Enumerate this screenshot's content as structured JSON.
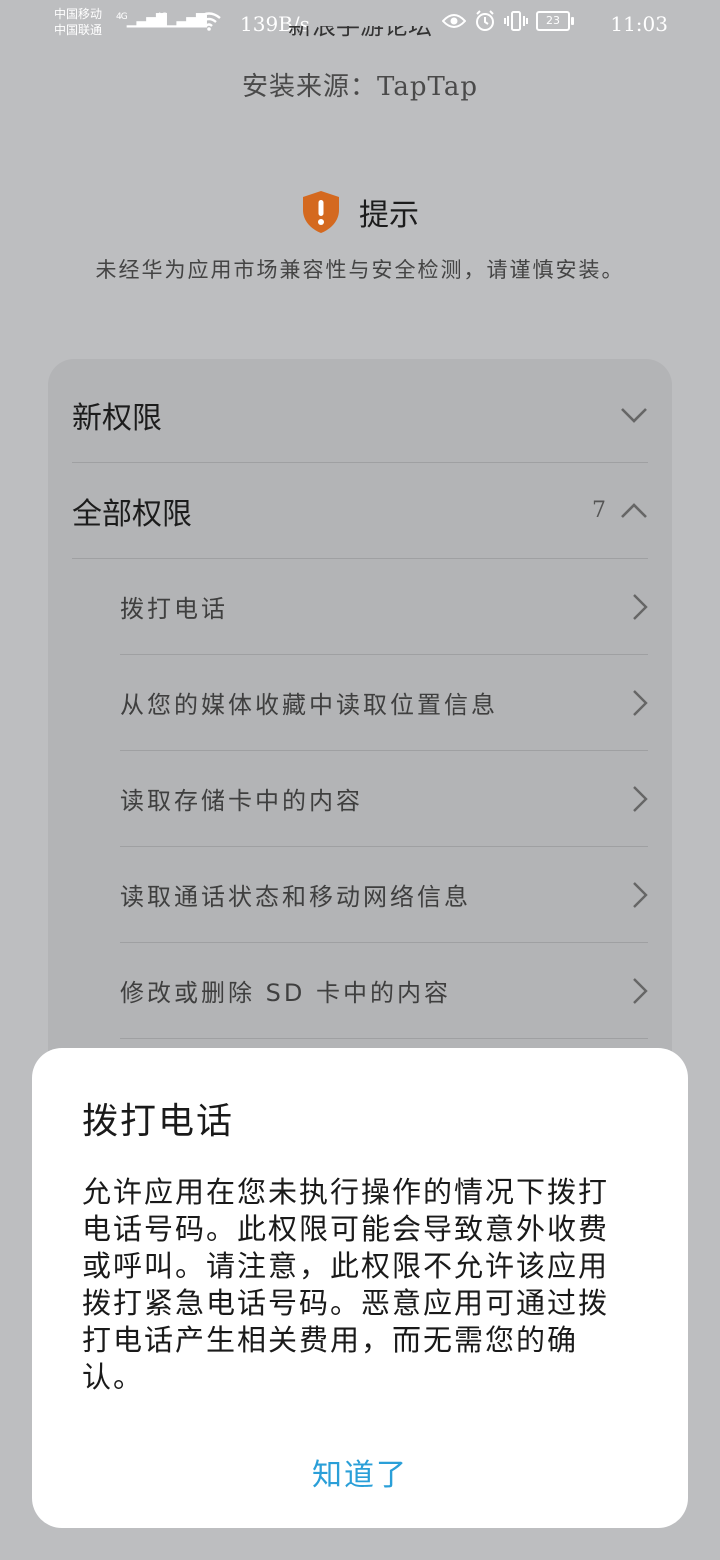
{
  "status_bar": {
    "carrier_1": "中国移动",
    "carrier_2": "中国联通",
    "signal_1_label": "4G",
    "signal_2_label": "4G",
    "net_speed": "139B/s",
    "battery": "23",
    "time": "11:03"
  },
  "header": {
    "cut_title": "新浪手游论坛",
    "install_source": "安装来源：TapTap"
  },
  "tip": {
    "icon": "shield-warning-icon",
    "icon_color": "#d4691f",
    "title": "提示",
    "text": "未经华为应用市场兼容性与安全检测，请谨慎安装。"
  },
  "permissions": {
    "new_label": "新权限",
    "all_label": "全部权限",
    "all_count": "7",
    "items": [
      "拨打电话",
      "从您的媒体收藏中读取位置信息",
      "读取存储卡中的内容",
      "读取通话状态和移动网络信息",
      "修改或删除 SD 卡中的内容"
    ]
  },
  "dialog": {
    "title": "拨打电话",
    "body": "允许应用在您未执行操作的情况下拨打电话号码。此权限可能会导致意外收费或呼叫。请注意，此权限不允许该应用拨打紧急电话号码。恶意应用可通过拨打电话产生相关费用，而无需您的确认。",
    "button": "知道了",
    "button_color": "#2a9fd8"
  }
}
